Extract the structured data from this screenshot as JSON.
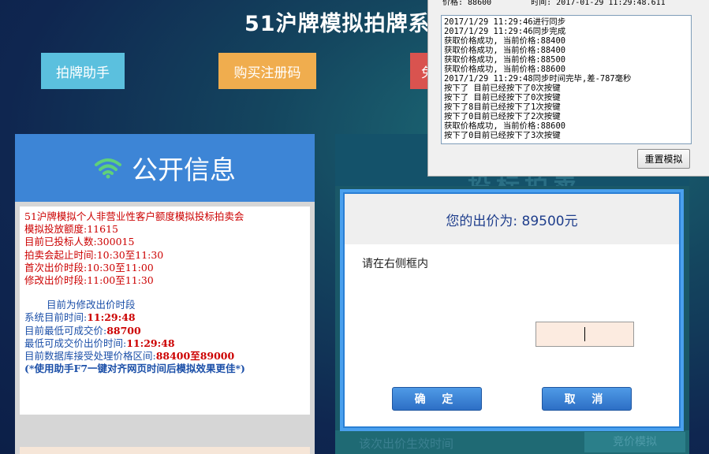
{
  "site": {
    "title": "51沪牌模拟拍牌系",
    "buttons": {
      "helper": "拍牌助手",
      "buy": "购买注册码",
      "partial": "免"
    }
  },
  "left_panel": {
    "title": "公开信息",
    "lines": {
      "auction_name": "51沪牌模拟个人非营业性客户额度模拟投标拍卖会",
      "quota": "模拟投放额度:11615",
      "bidders": "目前已投标人数:300015",
      "session_time": "拍卖会起止时间:10:30至11:30",
      "first_period": "首次出价时段:10:30至11:00",
      "modify_period": "修改出价时段:11:00至11:30",
      "current_phase": "目前为修改出价时段",
      "system_time_label": "系统目前时间:",
      "system_time_value": "11:29:48",
      "min_price_label": "目前最低可成交价:",
      "min_price_value": "88700",
      "min_price_time_label": "最低可成交价出价时间:",
      "min_price_time_value": "11:29:48",
      "range_label": "目前数据库接受处理价格区间:",
      "range_value": "88400至89000",
      "tip": "(*使用助手F7一键对齐网页时间后模拟效果更佳*)"
    }
  },
  "right_panel": {
    "header_text": "投标拍卖",
    "bottom_text": "该次出价生效时间",
    "bottom_button": "竞价模拟"
  },
  "bid_dialog": {
    "title": "您的出价为:  89500元",
    "prompt": "请在右侧框内",
    "ok_label": "确 定",
    "cancel_label": "取 消"
  },
  "log_window": {
    "header": {
      "price_label": "价格:",
      "price_value": "88600",
      "time_label": "时间:",
      "time_value": "2017-01-29 11:29:48.611"
    },
    "lines": [
      "2017/1/29 11:29:46进行同步",
      "2017/1/29 11:29:46同步完成",
      "获取价格成功, 当前价格:88400",
      "获取价格成功, 当前价格:88400",
      "获取价格成功, 当前价格:88500",
      "获取价格成功, 当前价格:88600",
      "2017/1/29 11:29:48同步时间完毕,差-787毫秒",
      "按下了 目前已经按下了0次按键",
      "按下了 目前已经按下了0次按键",
      "按下了8目前已经按下了1次按键",
      "按下了0目前已经按下了2次按键",
      "获取价格成功, 当前价格:88600",
      "按下了0目前已经按下了3次按键"
    ],
    "reset_label": "重置模拟"
  },
  "colors": {
    "helper_button": "#5bc0de",
    "buy_button": "#f0ad4e",
    "partial_button": "#d9534f",
    "left_header": "#3d85d6",
    "dialog_border": "#4aa0ee"
  }
}
